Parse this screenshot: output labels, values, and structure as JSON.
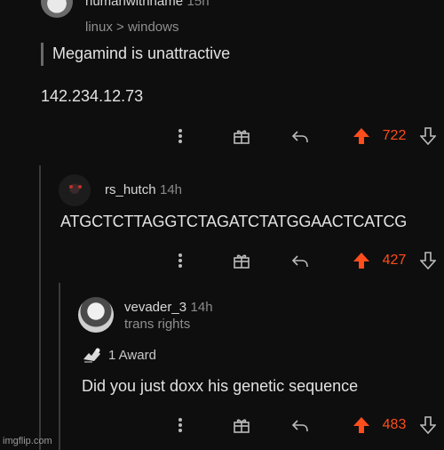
{
  "comments": [
    {
      "username": "humanwithname",
      "time": "15h",
      "flair": "linux > windows",
      "quote": "Megamind is unattractive",
      "body": "142.234.12.73",
      "votes": "722"
    },
    {
      "username": "rs_hutch",
      "time": "14h",
      "body": "ATGCTCTTAGGTCTAGATCTATGGAACTCATCG",
      "votes": "427"
    },
    {
      "username": "vevader_3",
      "time": "14h",
      "flair": "trans rights",
      "award": "1 Award",
      "body": "Did you just doxx his genetic sequence",
      "votes": "483"
    }
  ],
  "watermark": "imgflip.com",
  "colors": {
    "upvote": "#ff4d1c",
    "background": "#0e0e0e"
  }
}
